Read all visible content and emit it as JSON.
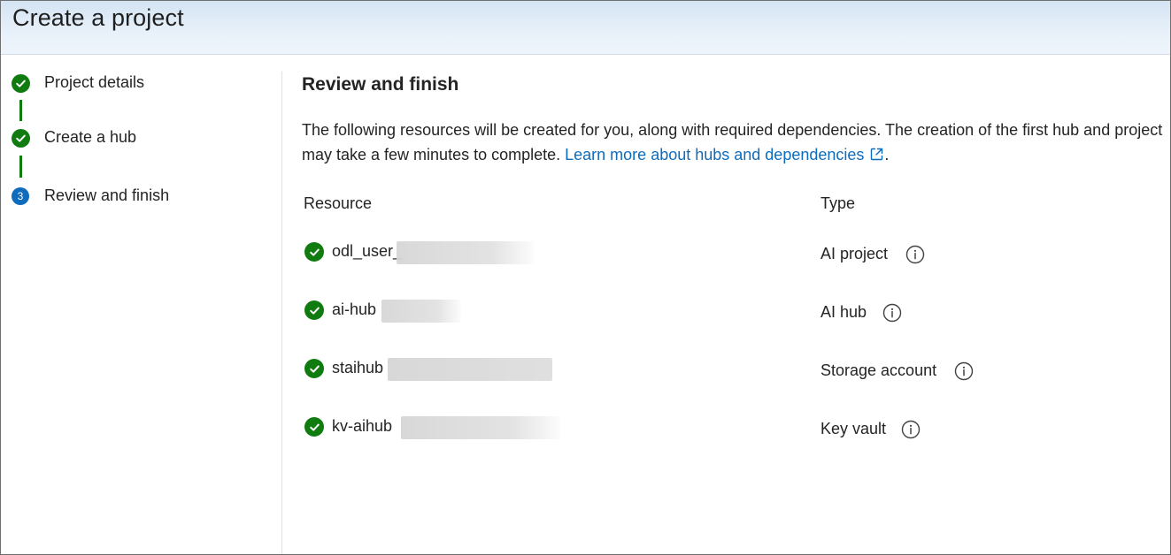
{
  "window": {
    "title": "Create a project"
  },
  "stepper": {
    "steps": [
      {
        "label": "Project details",
        "status": "done",
        "icon": "checkmark-circle-icon"
      },
      {
        "label": "Create a hub",
        "status": "done",
        "icon": "checkmark-circle-icon"
      },
      {
        "label": "Review and finish",
        "status": "current",
        "number": "3"
      }
    ]
  },
  "main": {
    "title": "Review and finish",
    "description": "The following resources will be created for you, along with required dependencies. The creation of the first hub and project may take a few minutes to complete. ",
    "link_text": "Learn more about hubs and dependencies",
    "link_suffix": ".",
    "table": {
      "headers": {
        "resource": "Resource",
        "type": "Type"
      },
      "rows": [
        {
          "resource": "odl_user_",
          "type": "AI project",
          "status_icon": "checkmark-circle-icon",
          "info_icon": "info-icon"
        },
        {
          "resource": "ai-hub",
          "type": "AI hub",
          "status_icon": "checkmark-circle-icon",
          "info_icon": "info-icon"
        },
        {
          "resource": "staihub",
          "type": "Storage account",
          "status_icon": "checkmark-circle-icon",
          "info_icon": "info-icon"
        },
        {
          "resource": "kv-aihub",
          "type": "Key vault",
          "status_icon": "checkmark-circle-icon",
          "info_icon": "info-icon"
        }
      ]
    }
  },
  "colors": {
    "success": "#107c10",
    "accent": "#0f6cbd",
    "header_bg": "#dce9f6"
  }
}
